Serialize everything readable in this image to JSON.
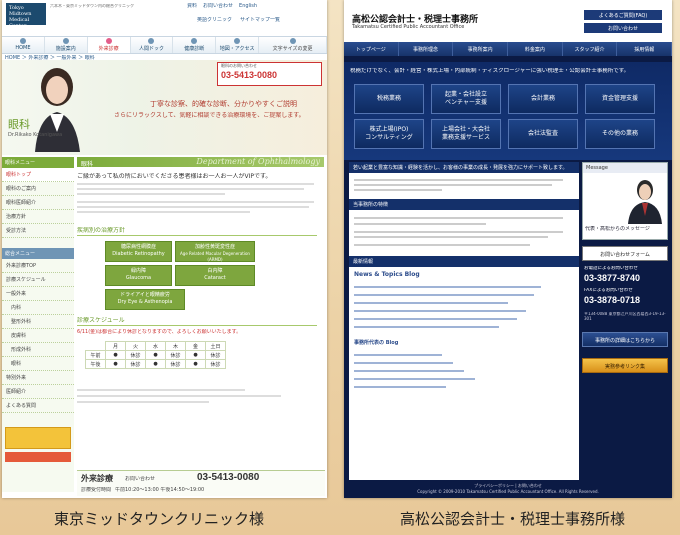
{
  "captions": {
    "left": "東京ミッドタウンクリニック様",
    "right": "高松公認会計士・税理士事務所様"
  },
  "site1": {
    "logo": [
      "Tokyo Midtown",
      "Medical Center"
    ],
    "top_links": [
      "資料",
      "お問い合わせ",
      "English"
    ],
    "sub_links": [
      "英語クリニック",
      "サイトマップ一覧"
    ],
    "font_size_label": "文字サイズの変更",
    "nav": [
      "HOME",
      "施設案内",
      "外来診療",
      "人間ドック",
      "健康診断",
      "地図・アクセス"
    ],
    "breadcrumb": "HOME ＞ 外来診療 ＞ 一般外来 ＞ 眼科",
    "hero": {
      "title": "眼科",
      "doctor": "Dr.Rikako Kotanigawa",
      "phone_label": "眼科のお問い合わせ",
      "phone": "03-5413-0080",
      "tagline1": "丁寧な診察、的確な診断、分かりやすくご説明",
      "tagline2": "さらにリラックスして、気軽に相談できる治療環境を、ご提案します。"
    },
    "side_head": "眼科メニュー",
    "side_items": [
      "眼科トップ",
      "眼科のご案内",
      "眼科医師紹介",
      "治療方針",
      "受診方法"
    ],
    "side_head2": "総合メニュー",
    "side_items2": [
      "外来診療TOP",
      "診療スケジュール",
      "一般外来",
      "内科",
      "整形外科",
      "皮膚科",
      "形成外科",
      "眼科",
      "特別外来",
      "医師紹介",
      "よくある質問"
    ],
    "section": "眼科",
    "section_en": "Department of Ophthalmology",
    "intro": "ご縁があって私の所においでくださる患者様はお一人お一人がVIPです。",
    "treat_head": "疾病別の治療方針",
    "treatments": [
      [
        "糖尿病性網膜症",
        "Diabetic Retinopathy"
      ],
      [
        "加齢性黄斑変性症",
        "Age Related Macular Degeneration (ARMD)"
      ],
      [
        "緑内障",
        "Glaucoma"
      ],
      [
        "白内障",
        "Cataract"
      ],
      [
        "ドライアイと眼精疲労",
        "Dry Eye & Asthenopia"
      ]
    ],
    "schedule_head": "診療スケジュール",
    "schedule_note": "6/11(金)は都合により休診となりますので、よろしくお願いいたします。",
    "days": [
      "月",
      "火",
      "水",
      "木",
      "金",
      "土日"
    ],
    "am_label": "午前",
    "pm_label": "午後",
    "am": [
      "●",
      "休診",
      "●",
      "休診",
      "●",
      "休診"
    ],
    "pm": [
      "●",
      "休診",
      "●",
      "休診",
      "●",
      "休診"
    ],
    "footer": {
      "title": "外来診療",
      "inquiry": "お問い合わせ",
      "phone": "03-5413-0080",
      "hours_label": "診療受付時間",
      "hours": "午前10:20〜13:00 午後14:50〜19:00"
    }
  },
  "site2": {
    "title": "高松公認会計士・税理士事務所",
    "subtitle": "Takamatsu Certified Public Accountant Office",
    "faq_btn": "よくあるご質問(FAQ)",
    "contact_btn": "お問い合わせ",
    "nav": [
      "トップページ",
      "事務所理念",
      "事務所案内",
      "料金案内",
      "スタッフ紹介",
      "採用情報"
    ],
    "band_text": "税務だけでなく、会計・経営・株式上場・内部統制・ディスクロージャーに強い税理士・公認会計士事務所です。",
    "services": [
      [
        "税務業務"
      ],
      [
        "起業・会社設立",
        "ベンチャー支援"
      ],
      [
        "会計業務"
      ],
      [
        "資金管理支援"
      ],
      [
        "株式上場(IPO)",
        "コンサルティング"
      ],
      [
        "上場会社・大会社",
        "業務支援サービス"
      ],
      [
        "会社法監査"
      ],
      [
        "その他の業務"
      ]
    ],
    "intro_head": "若い起業と豊富な知識・経験を活かし、お客様の事業の成長・発展を強力にサポート致します。",
    "feature_head": "当事務所の特徴",
    "news_head": "最新情報",
    "blog_head": "News & Topics Blog",
    "blog2_head": "事務所代表の Blog",
    "message_head": "Message",
    "representative": "代表・高松からのメッセージ",
    "form_btn": "お問い合わせフォーム",
    "tel_label": "お電話によるお問い合わせ",
    "tel": "03-3877-8740",
    "fax_label": "FAXによるお問い合わせ",
    "fax": "03-3878-0718",
    "address": "〒134-0088 東京都江戸川区西葛西3-19-13-301",
    "detail_btn": "事務所の詳細はこちらから",
    "link_btn": "実務参考リンク集",
    "footer": "プライバシーポリシー | お問い合わせ",
    "copyright": "Copyright © 2009-2010 Takamatsu Certified Public Accountant Office. All Rights Reserved."
  }
}
